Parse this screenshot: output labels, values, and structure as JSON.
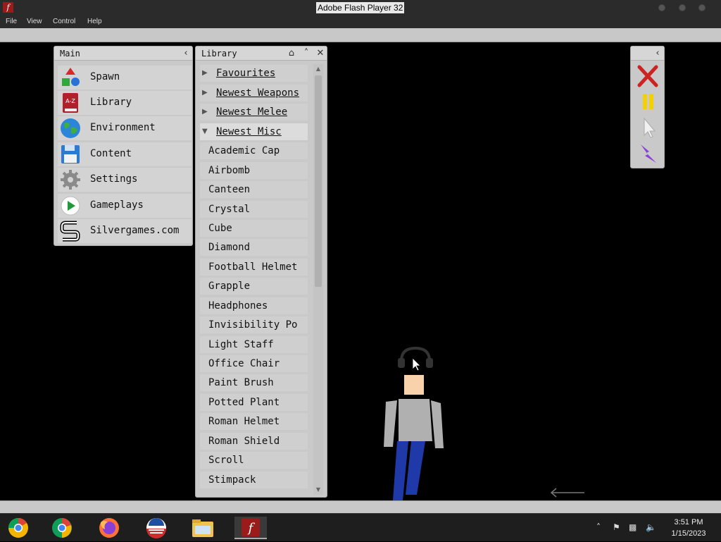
{
  "window": {
    "title": "Adobe Flash Player 32"
  },
  "menu": {
    "items": [
      "File",
      "View",
      "Control",
      "Help"
    ]
  },
  "main_panel": {
    "title": "Main",
    "items": [
      {
        "label": "Spawn",
        "icon": "shapes-icon"
      },
      {
        "label": "Library",
        "icon": "book-icon"
      },
      {
        "label": "Environment",
        "icon": "globe-icon"
      },
      {
        "label": "Content",
        "icon": "floppy-disk-icon"
      },
      {
        "label": "Settings",
        "icon": "gear-icon"
      },
      {
        "label": "Gameplays",
        "icon": "play-icon"
      },
      {
        "label": "Silvergames.com",
        "icon": "silvergames-logo-icon"
      }
    ]
  },
  "library_panel": {
    "title": "Library",
    "categories": [
      {
        "label": "Favourites",
        "expanded": false
      },
      {
        "label": "Newest Weapons",
        "expanded": false
      },
      {
        "label": "Newest Melee",
        "expanded": false
      },
      {
        "label": "Newest Misc",
        "expanded": true
      }
    ],
    "items": [
      "Academic Cap",
      "Airbomb",
      "Canteen",
      "Crystal",
      "Cube",
      "Diamond",
      "Football Helmet",
      "Grapple",
      "Headphones",
      "Invisibility Potion",
      "Light Staff",
      "Office Chair",
      "Paint Brush",
      "Potted Plant",
      "Roman Helmet",
      "Roman Shield",
      "Scroll",
      "Stimpack"
    ]
  },
  "tools": [
    "close-x-icon",
    "pause-icon",
    "pointer-cursor-icon",
    "lightning-icon"
  ],
  "taskbar": {
    "apps": [
      "chrome-canary-icon",
      "chrome-icon",
      "firefox-icon",
      "obama-logo-icon",
      "file-explorer-icon",
      "flash-player-icon"
    ],
    "time": "3:51 PM",
    "date": "1/15/2023"
  },
  "colors": {
    "accent_red": "#cc2222",
    "pause_yellow": "#f5d000",
    "lightning_purple": "#8a3fd6"
  }
}
